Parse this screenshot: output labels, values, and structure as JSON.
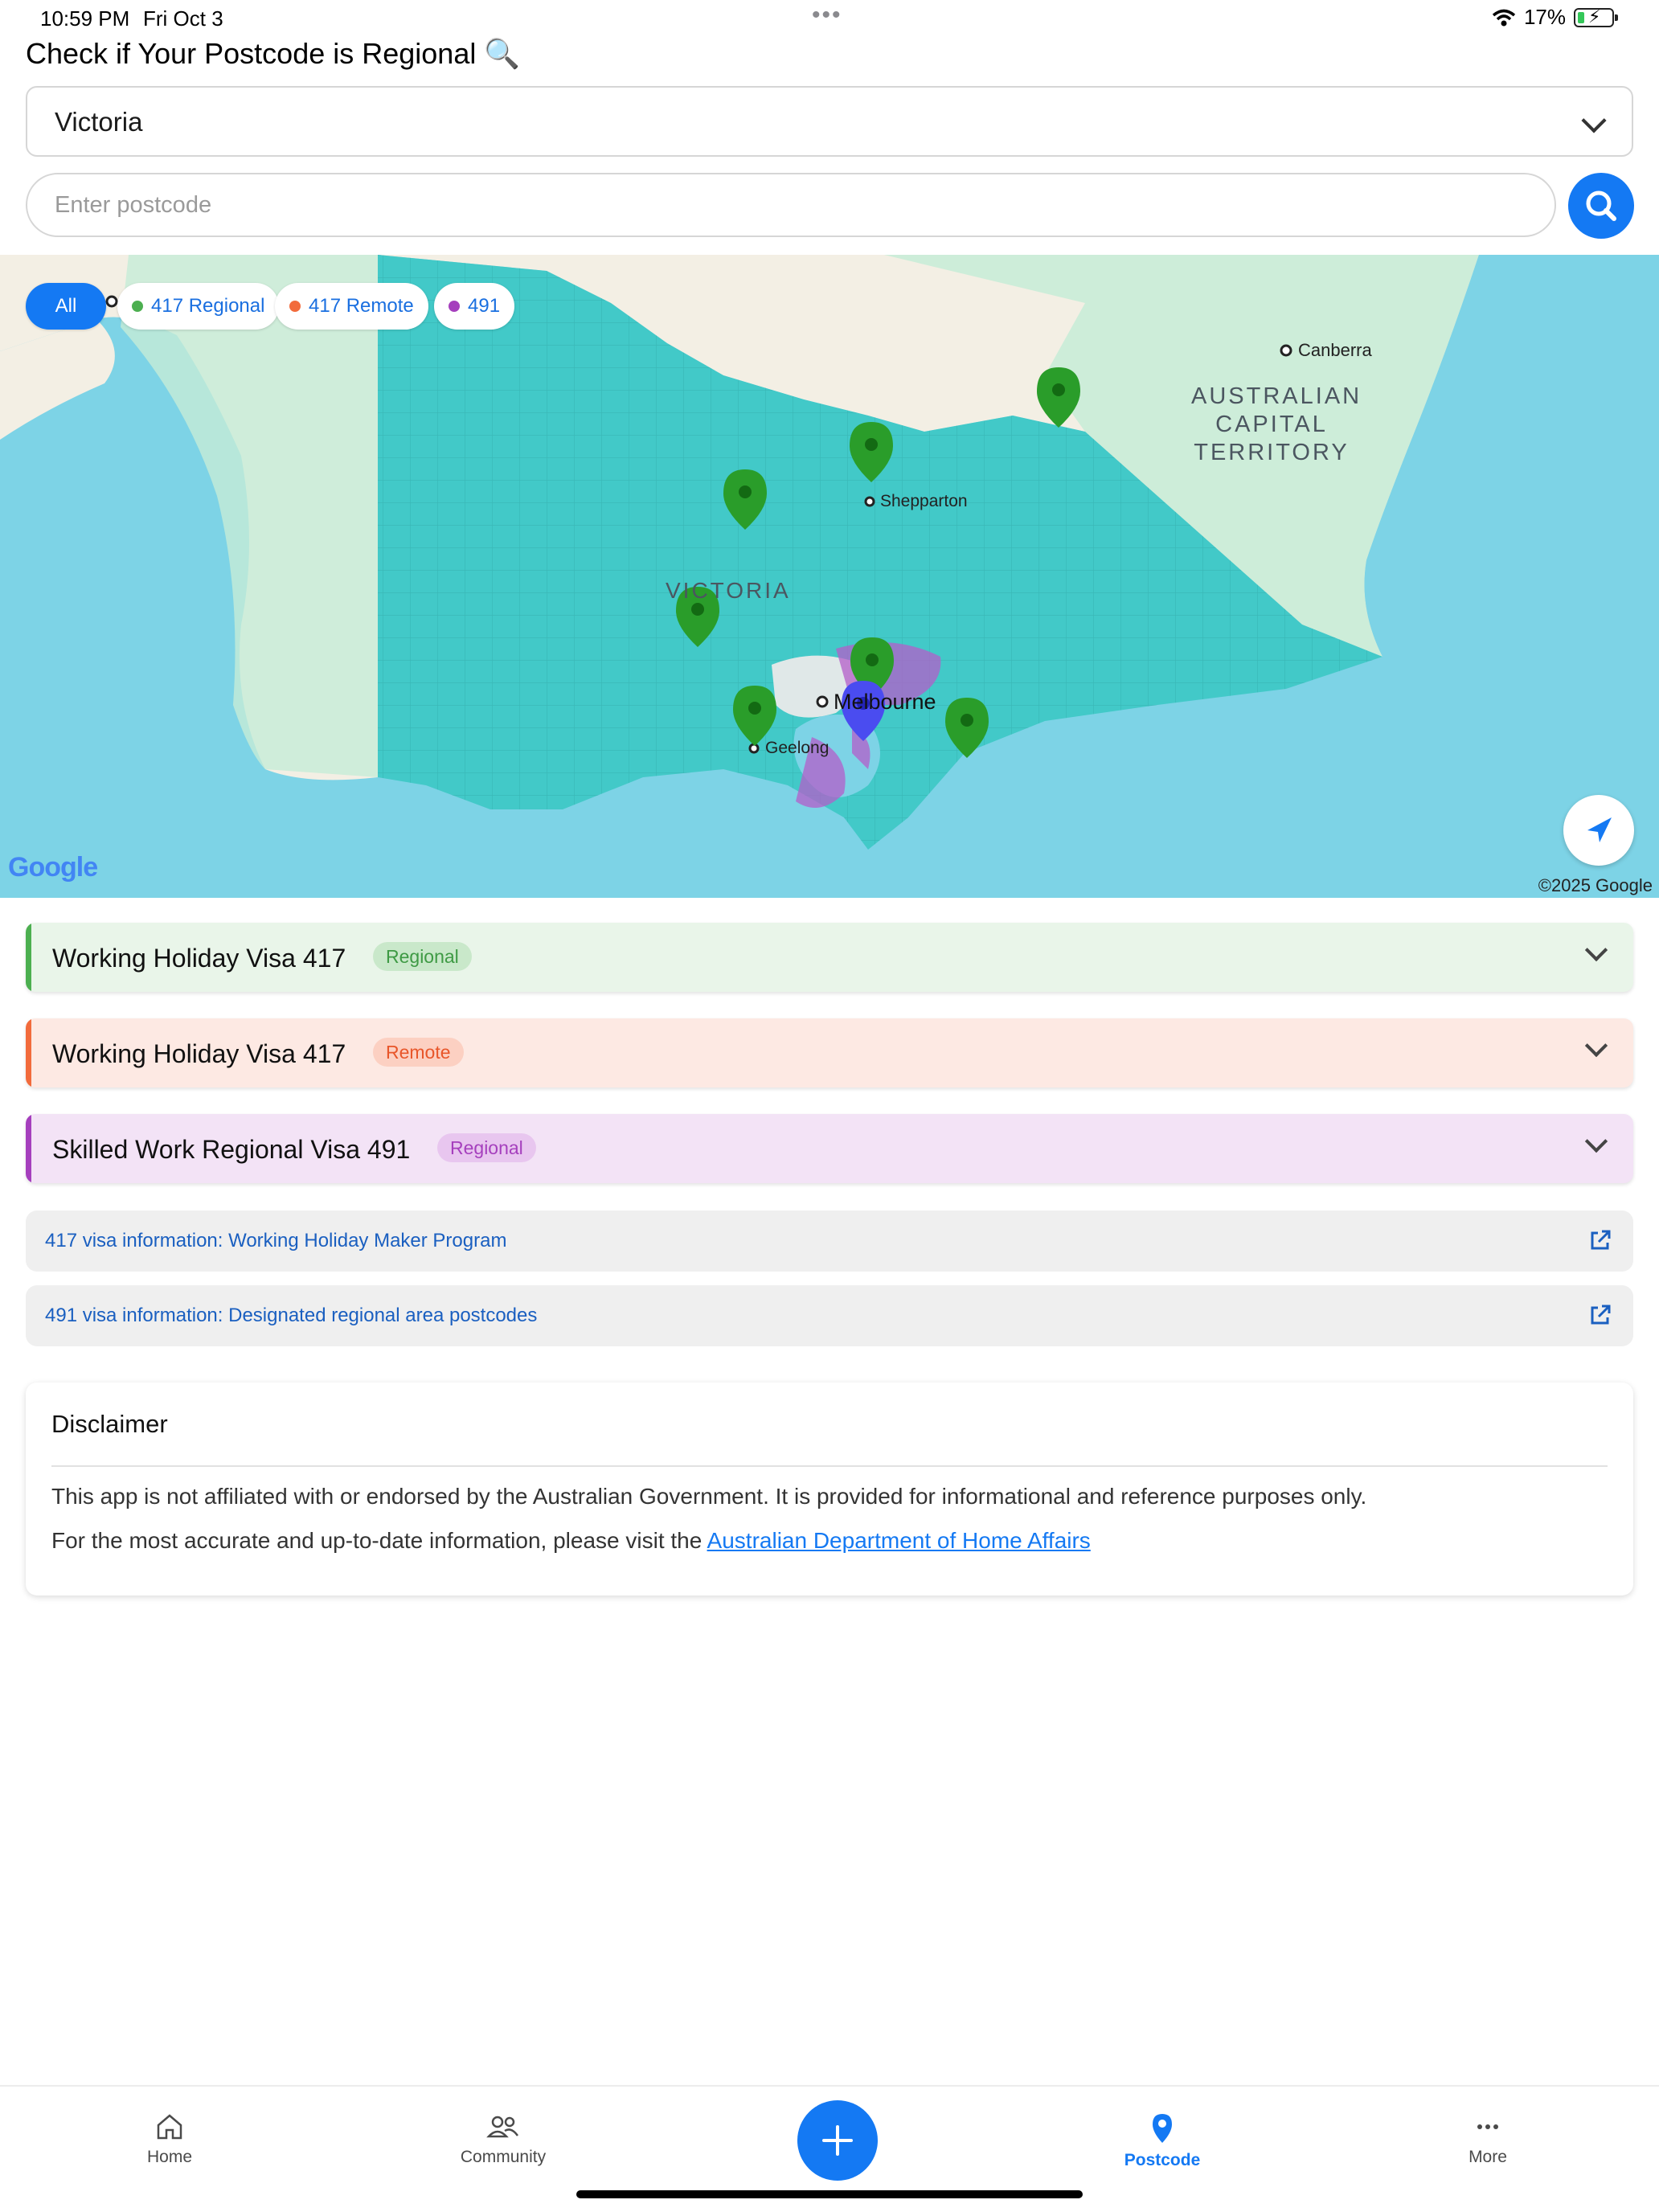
{
  "status_bar": {
    "time": "10:59 PM",
    "date": "Fri Oct 3",
    "battery": "17%"
  },
  "page_title": "Check if Your Postcode is Regional 🔍",
  "state_select": {
    "value": "Victoria"
  },
  "postcode_input": {
    "placeholder": "Enter postcode",
    "value": ""
  },
  "map": {
    "filters": [
      {
        "label": "All",
        "active": true
      },
      {
        "label": "417 Regional",
        "color": "#4caf50"
      },
      {
        "label": "417 Remote",
        "color": "#f26b3c"
      },
      {
        "label": "491",
        "color": "#a53fbd"
      }
    ],
    "labels": {
      "canberra": "Canberra",
      "act_1": "AUSTRALIAN",
      "act_2": "CAPITAL",
      "act_3": "TERRITORY",
      "victoria": "VICTORIA",
      "shepparton": "Shepparton",
      "melbourne": "Melbourne",
      "geelong": "Geelong"
    },
    "logo": "Google",
    "copyright": "©2025 Google",
    "colors": {
      "regional_fill": "#3cc8c4",
      "metro_491": "#b45ec9",
      "water": "#7dd3e6",
      "land": "#f3efe4"
    }
  },
  "visa_cards": [
    {
      "title": "Working Holiday Visa 417",
      "badge": "Regional"
    },
    {
      "title": "Working Holiday Visa 417",
      "badge": "Remote"
    },
    {
      "title": "Skilled Work Regional Visa 491",
      "badge": "Regional"
    }
  ],
  "info_links": [
    "417 visa information: Working Holiday Maker Program",
    "491 visa information: Designated regional area postcodes"
  ],
  "disclaimer": {
    "title": "Disclaimer",
    "p1": "This app is not affiliated with or endorsed by the Australian Government. It is provided for informational and reference purposes only.",
    "p2_prefix": "For the most accurate and up-to-date information, please visit the ",
    "p2_link": "Australian Department of Home Affairs"
  },
  "tab_bar": {
    "home": "Home",
    "community": "Community",
    "postcode": "Postcode",
    "more": "More",
    "active": "Postcode"
  }
}
